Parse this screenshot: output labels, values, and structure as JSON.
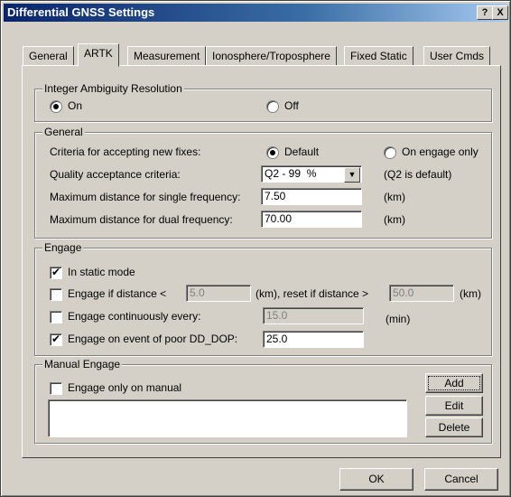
{
  "window": {
    "title": "Differential GNSS Settings",
    "help_label": "?",
    "close_label": "X"
  },
  "tabs": [
    "General",
    "ARTK",
    "Measurement",
    "Ionosphere/Troposphere",
    "Fixed Static",
    "User Cmds"
  ],
  "integer_ambiguity": {
    "title": "Integer Ambiguity Resolution",
    "on_label": "On",
    "off_label": "Off",
    "selected": "On"
  },
  "general": {
    "title": "General",
    "criteria_label": "Criteria for accepting new fixes:",
    "criteria_default_label": "Default",
    "criteria_engage_label": "On engage only",
    "criteria_selected": "Default",
    "quality_label": "Quality acceptance criteria:",
    "quality_value": "Q2 - 99  %",
    "quality_note": "(Q2 is default)",
    "single_freq_label": "Maximum distance for single frequency:",
    "single_freq_value": "7.50",
    "single_freq_unit": "(km)",
    "dual_freq_label": "Maximum distance for dual frequency:",
    "dual_freq_value": "70.00",
    "dual_freq_unit": "(km)"
  },
  "engage": {
    "title": "Engage",
    "static_label": "In static mode",
    "static_checked": true,
    "distance_label": "Engage if distance <",
    "distance_value": "5.0",
    "distance_checked": false,
    "reset_label": "(km), reset if distance >",
    "reset_value": "50.0",
    "reset_unit": "(km)",
    "continuous_label": "Engage continuously every:",
    "continuous_value": "15.0",
    "continuous_unit": "(min)",
    "continuous_checked": false,
    "poor_ddop_label": "Engage on event of poor DD_DOP:",
    "poor_ddop_value": "25.0",
    "poor_ddop_checked": true
  },
  "manual": {
    "title": "Manual Engage",
    "only_manual_label": "Engage only on manual",
    "only_manual_checked": false,
    "add_label": "Add",
    "edit_label": "Edit",
    "delete_label": "Delete"
  },
  "footer": {
    "ok_label": "OK",
    "cancel_label": "Cancel"
  }
}
